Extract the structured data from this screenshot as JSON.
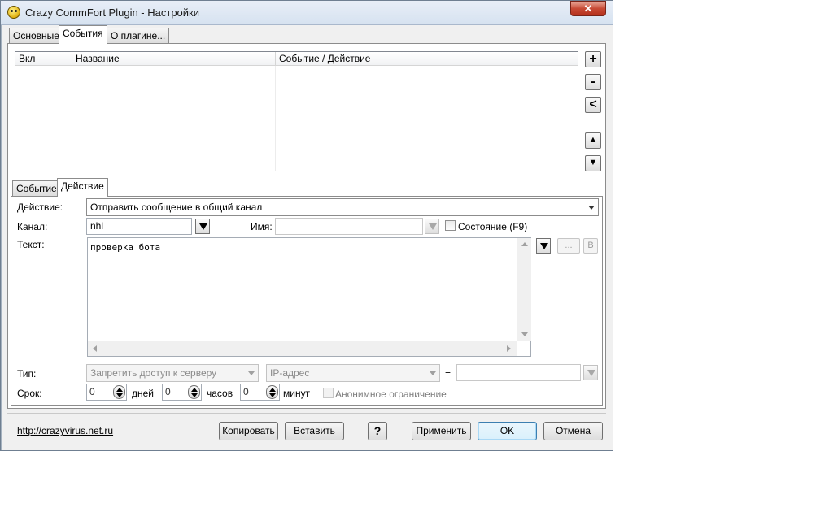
{
  "window": {
    "title": "Crazy CommFort Plugin - Настройки",
    "close_label": "✕"
  },
  "main_tabs": [
    {
      "label": "Основные",
      "active": false
    },
    {
      "label": "События",
      "active": true
    },
    {
      "label": "О плагине...",
      "active": false
    }
  ],
  "events_list": {
    "columns": [
      "Вкл",
      "Название",
      "Событие / Действие"
    ],
    "rows": []
  },
  "side_buttons": {
    "add": "+",
    "remove": "-",
    "left": "<",
    "up": "▲",
    "down": "▼"
  },
  "sub_tabs": [
    {
      "label": "Событие",
      "active": false
    },
    {
      "label": "Действие",
      "active": true
    }
  ],
  "action_form": {
    "action_label": "Действие:",
    "action_value": "Отправить сообщение в общий канал",
    "channel_label": "Канал:",
    "channel_value": "nhl",
    "name_label": "Имя:",
    "name_value": "",
    "state_label": "Состояние (F9)",
    "state_checked": false,
    "text_label": "Текст:",
    "text_value": "проверка бота",
    "dots_button": "...",
    "b_button": "B",
    "type_label": "Тип:",
    "type_value": "Запретить доступ к серверу",
    "ip_value": "IP-адрес",
    "equals": "=",
    "ip_field_value": "",
    "term_label": "Срок:",
    "days_value": "0",
    "days_label": "дней",
    "hours_value": "0",
    "hours_label": "часов",
    "minutes_value": "0",
    "minutes_label": "минут",
    "anon_label": "Анонимное ограничение",
    "anon_checked": false
  },
  "footer": {
    "link": "http://crazyvirus.net.ru",
    "copy": "Копировать",
    "paste": "Вставить",
    "help": "?",
    "apply": "Применить",
    "ok": "OK",
    "cancel": "Отмена"
  }
}
